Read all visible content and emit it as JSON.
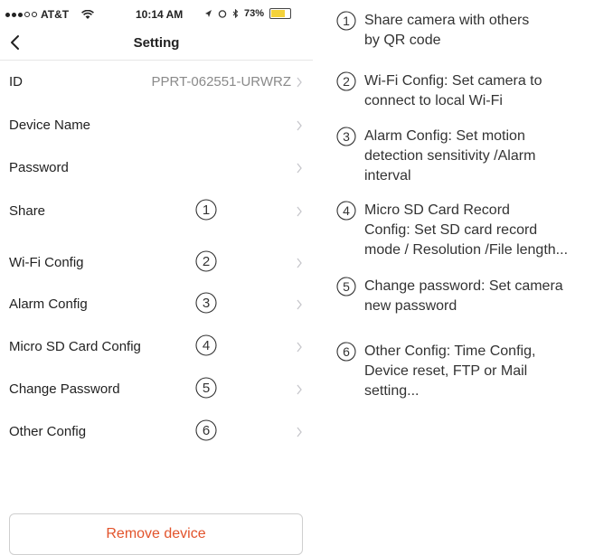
{
  "status_bar": {
    "carrier": "AT&T",
    "time": "10:14 AM",
    "battery": "73%",
    "battery_level": 0.73
  },
  "nav": {
    "title": "Setting"
  },
  "rows": [
    {
      "label": "ID",
      "value": "PPRT-062551-URWRZ"
    },
    {
      "label": "Device Name"
    },
    {
      "label": "Password"
    },
    {
      "label": "Share",
      "badge": "1"
    },
    {
      "label": "Wi-Fi Config",
      "badge": "2"
    },
    {
      "label": "Alarm Config",
      "badge": "3"
    },
    {
      "label": "Micro SD Card Config",
      "badge": "4"
    },
    {
      "label": "Change Password",
      "badge": "5"
    },
    {
      "label": "Other Config",
      "badge": "6"
    }
  ],
  "remove_button": "Remove device",
  "notes": [
    {
      "badge": "1",
      "lines": [
        "Share camera with others",
        "by QR code"
      ]
    },
    {
      "badge": "2",
      "lines": [
        "Wi-Fi Config: Set camera to",
        "connect to local Wi-Fi"
      ]
    },
    {
      "badge": "3",
      "lines": [
        "Alarm Config: Set motion",
        "detection sensitivity /Alarm",
        "interval"
      ]
    },
    {
      "badge": "4",
      "lines": [
        "Micro SD Card Record",
        "Config: Set SD card record",
        "mode / Resolution /File length..."
      ]
    },
    {
      "badge": "5",
      "lines": [
        "Change password: Set camera",
        "new password"
      ]
    },
    {
      "badge": "6",
      "lines": [
        "Other Config: Time Config,",
        "Device reset, FTP or Mail",
        "setting..."
      ]
    }
  ],
  "colors": {
    "accent_red": "#e2532b",
    "chevron": "#c7c7cc",
    "battery": "#f4d23a"
  },
  "icons": {
    "back": "chevron-left-icon",
    "row_arrow": "chevron-right-icon",
    "wifi": "wifi-icon",
    "signal": "signal-dots-icon"
  }
}
